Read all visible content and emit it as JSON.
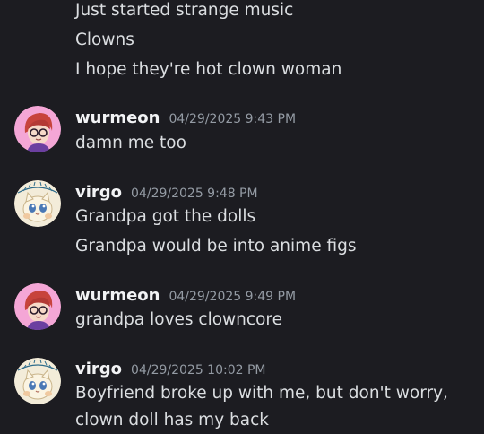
{
  "messages": [
    {
      "continuation": true,
      "lines": [
        "Just started strange music",
        "Clowns",
        "I hope they're hot clown woman"
      ]
    },
    {
      "author": "wurmeon",
      "timestamp": "04/29/2025 9:43 PM",
      "avatar_icon": "pink-haired-girl-avatar-icon",
      "lines": [
        "damn me too"
      ]
    },
    {
      "author": "virgo",
      "timestamp": "04/29/2025 9:48 PM",
      "avatar_icon": "cream-cat-avatar-icon",
      "lines": [
        "Grandpa got the dolls",
        "Grandpa would be into anime figs"
      ]
    },
    {
      "author": "wurmeon",
      "timestamp": "04/29/2025 9:49 PM",
      "avatar_icon": "pink-haired-girl-avatar-icon",
      "lines": [
        "grandpa loves clowncore"
      ]
    },
    {
      "author": "virgo",
      "timestamp": "04/29/2025 10:02 PM",
      "avatar_icon": "cream-cat-avatar-icon",
      "lines": [
        "Boyfriend broke up with me, but don't worry,",
        "clown doll has my back"
      ]
    }
  ],
  "colors": {
    "background": "#1c1c21",
    "username": "#f2f3f5",
    "timestamp": "#949ba4",
    "message_text": "#dbdee1"
  }
}
